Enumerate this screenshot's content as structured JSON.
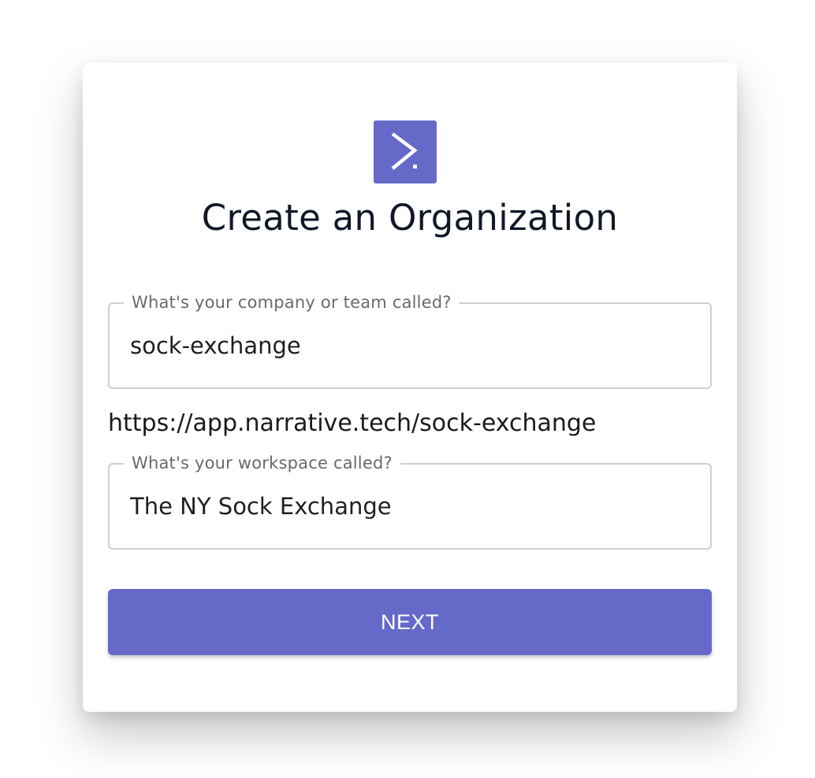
{
  "card": {
    "logo_icon": "terminal-prompt-icon",
    "title": "Create an Organization"
  },
  "company_field": {
    "label": "What's your company or team called?",
    "value": "sock-exchange"
  },
  "url_preview": "https://app.narrative.tech/sock-exchange",
  "workspace_field": {
    "label": "What's your workspace called?",
    "value": "The NY Sock Exchange"
  },
  "next_button": {
    "label": "NEXT"
  },
  "colors": {
    "accent": "#6569c8",
    "field_border": "#cfcfcf",
    "label_text": "#666a70"
  }
}
